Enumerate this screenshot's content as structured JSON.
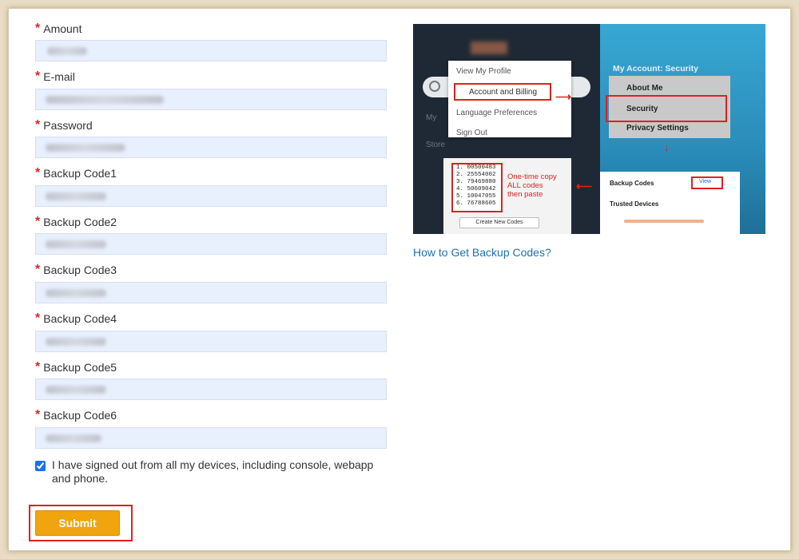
{
  "form": {
    "fields": [
      {
        "label": "Amount",
        "required": true
      },
      {
        "label": "E-mail",
        "required": true
      },
      {
        "label": "Password",
        "required": true
      },
      {
        "label": "Backup Code1",
        "required": true
      },
      {
        "label": "Backup Code2",
        "required": true
      },
      {
        "label": "Backup Code3",
        "required": true
      },
      {
        "label": "Backup Code4",
        "required": true
      },
      {
        "label": "Backup Code5",
        "required": true
      },
      {
        "label": "Backup Code6",
        "required": true
      }
    ],
    "required_mark": "*",
    "consent": {
      "checked": true,
      "text": "I have signed out from all my devices, including console, webapp and phone."
    },
    "submit_label": "Submit"
  },
  "guide": {
    "menu_items": [
      "View My Profile",
      "Account and Billing",
      "Language Preferences",
      "Sign Out"
    ],
    "side_items": [
      "My",
      "Store"
    ],
    "security_title": "My Account: Security",
    "security_items": [
      "About Me",
      "Security",
      "Privacy Settings"
    ],
    "codes": [
      "1. 00500483",
      "2. 25554002",
      "3. 79469880",
      "4. 50609042",
      "5. 10047055",
      "6. 76788605"
    ],
    "create_codes_label": "Create New Codes",
    "annotation": [
      "One-time copy",
      "ALL codes",
      "then paste"
    ],
    "backup_codes_label": "Backup Codes",
    "view_label": "View",
    "trusted_devices_label": "Trusted Devices"
  },
  "help_link": "How to Get Backup Codes?",
  "colors": {
    "required": "#d9252a",
    "input_bg": "#e8effd",
    "submit_bg": "#f0a50e",
    "highlight": "#e02020",
    "link": "#1f6fb5"
  }
}
